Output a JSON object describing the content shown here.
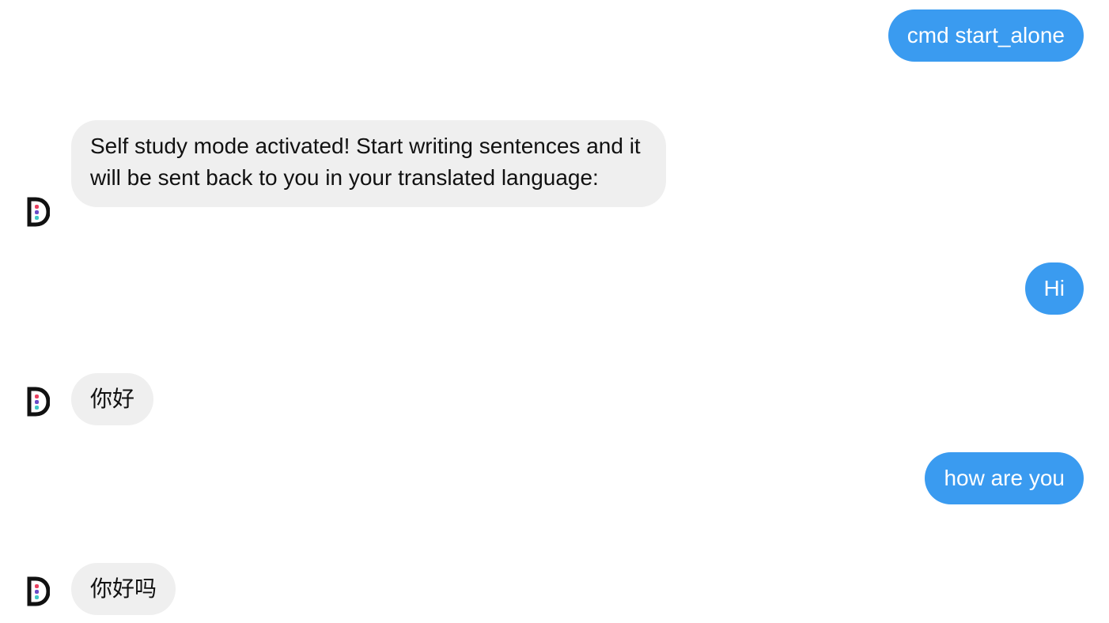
{
  "chat": {
    "messages": [
      {
        "sender": "user",
        "text": "cmd start_alone"
      },
      {
        "sender": "bot",
        "text": "Self study mode activated! Start writing sentences and it will be sent back to you in your translated language:"
      },
      {
        "sender": "user",
        "text": "Hi"
      },
      {
        "sender": "bot",
        "text": "你好"
      },
      {
        "sender": "user",
        "text": "how are you"
      },
      {
        "sender": "bot",
        "text": "你好吗"
      }
    ],
    "bot_avatar_icon": "bot-logo-icon"
  },
  "colors": {
    "outgoing_bubble": "#3a9bf0",
    "incoming_bubble": "#efefef",
    "background": "#ffffff"
  }
}
